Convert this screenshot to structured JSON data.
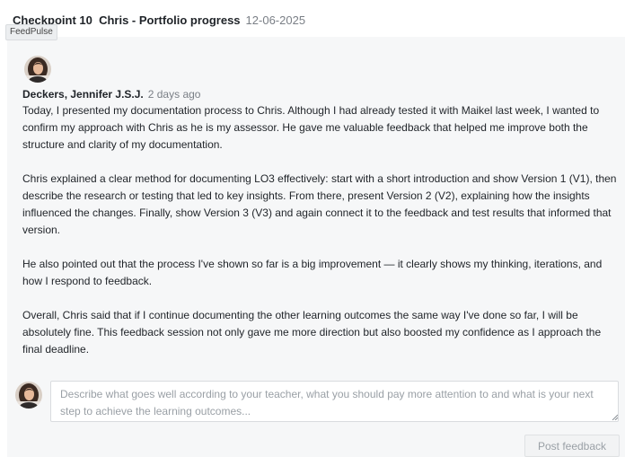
{
  "app": {
    "name": "FeedPulse"
  },
  "header": {
    "title": "Checkpoint 10  Chris - Portfolio progress",
    "date": "12-06-2025"
  },
  "post": {
    "author": "Deckers, Jennifer J.S.J.",
    "time": "2 days ago",
    "paragraphs": [
      "Today, I presented my documentation process to Chris. Although I had already tested it with Maikel last week, I wanted to confirm my approach with Chris as he is my assessor. He gave me valuable feedback that helped me improve both the structure and clarity of my documentation.",
      "Chris explained a clear method for documenting LO3 effectively: start with a short introduction and show Version 1 (V1), then describe the research or testing that led to key insights. From there, present Version 2 (V2), explaining how the insights influenced the changes. Finally, show Version 3 (V3) and again connect it to the feedback and test results that informed that version.",
      "He also pointed out that the process I've shown so far is a big improvement — it clearly shows my thinking, iterations, and how I respond to feedback.",
      "Overall, Chris said that if I continue documenting the other learning outcomes the same way I've done so far, I will be absolutely fine. This feedback session not only gave me more direction but also boosted my confidence as I approach the final deadline."
    ]
  },
  "comment": {
    "value": "",
    "placeholder": "Describe what goes well according to your teacher, what you should pay more attention to and what is your next step to achieve the learning outcomes...",
    "submit_label": "Post feedback"
  }
}
